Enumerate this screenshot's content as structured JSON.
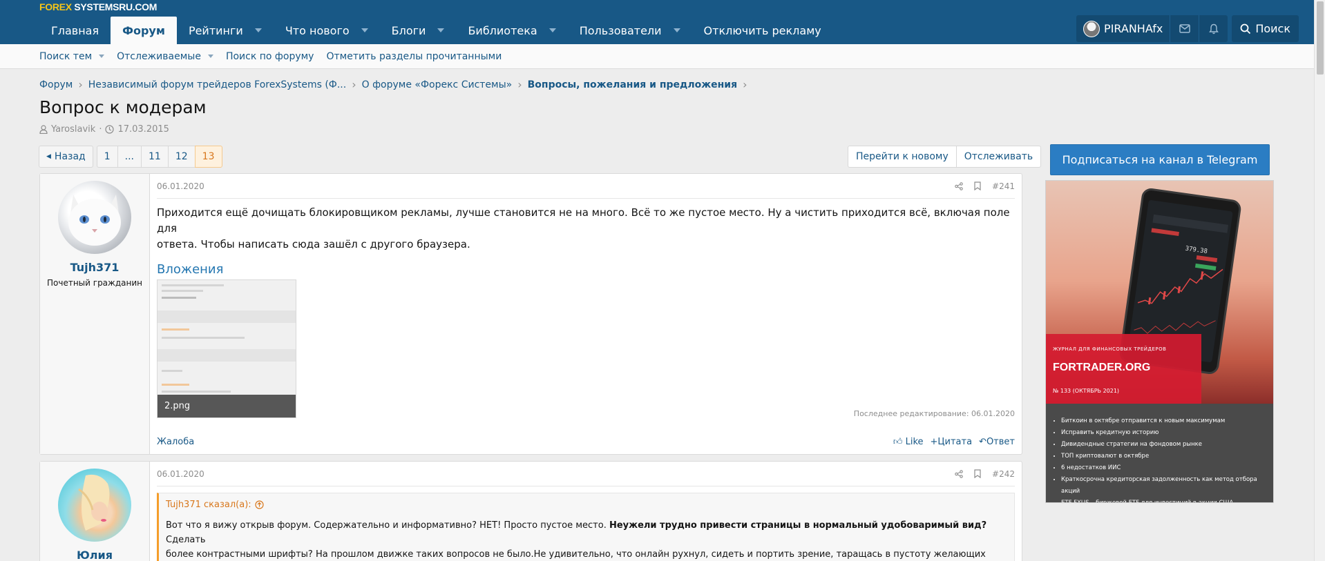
{
  "logo": {
    "part1": "FOREX",
    "part2": " SYSTEMSRU.COM"
  },
  "nav": {
    "items": [
      {
        "label": "Главная"
      },
      {
        "label": "Форум"
      },
      {
        "label": "Рейтинги"
      },
      {
        "label": "Что нового"
      },
      {
        "label": "Блоги"
      },
      {
        "label": "Библиотека"
      },
      {
        "label": "Пользователи"
      },
      {
        "label": "Отключить рекламу"
      }
    ],
    "active": "Форум",
    "username": "PIRANHAfx",
    "search_label": "Поиск"
  },
  "subnav": {
    "items": [
      {
        "label": "Поиск тем"
      },
      {
        "label": "Отслеживаемые"
      },
      {
        "label": "Поиск по форуму"
      },
      {
        "label": "Отметить разделы прочитанными"
      }
    ]
  },
  "breadcrumb": [
    "Форум",
    "Независимый форум трейдеров ForexSystems (Ф...",
    "О форуме «Форекс Системы»",
    "Вопросы, пожелания и предложения"
  ],
  "thread": {
    "title": "Вопрос к модерам",
    "author": "Yaroslavik",
    "date": "17.03.2015"
  },
  "pager": {
    "back": "Назад",
    "pages": [
      "1",
      "...",
      "11",
      "12",
      "13"
    ],
    "current": "13"
  },
  "thread_actions": {
    "goto_new": "Перейти к новому",
    "watch": "Отслеживать"
  },
  "posts": [
    {
      "username": "Tujh371",
      "usertitle": "Почетный гражданин",
      "date": "06.01.2020",
      "number": "#241",
      "body_line1": "Приходится ещё дочищать блокировщиком рекламы, лучше становится не на много. Всё то же пустое место. Ну а чистить приходится всё, включая поле для",
      "body_line2": "ответа. Чтобы написать сюда зашёл с другого браузера.",
      "attachments_label": "Вложения",
      "attachment_name": "2.png",
      "edited": "Последнее редактирование: 06.01.2020",
      "report": "Жалоба",
      "like": "Like",
      "quote": "Цитата",
      "reply": "Ответ"
    },
    {
      "username": "Юлия",
      "date": "06.01.2020",
      "number": "#242",
      "quote_author": "Tujh371 сказал(а):",
      "quote_text_start": "Вот что я вижу открыв форум. Содержательно и информативно? НЕТ! Просто пустое место. ",
      "quote_text_bold": "Неужели трудно привести страницы в нормальный удобоваримый вид?",
      "quote_text_end": " Сделать",
      "quote_line2": "более контрастными шрифты? На прошлом движке таких вопросов не было.Не удивительно, что онлайн рухнул, сидеть и портить зрение, таращась в пустоту желающих мало???"
    }
  ],
  "telegram": {
    "button": "Подписаться на канал в Telegram",
    "ad": {
      "kicker": "ЖУРНАЛ ДЛЯ ФИНАНСОВЫХ ТРЕЙДЕРОВ",
      "brand": "FORTRADER.ORG",
      "issue": "№ 133 (ОКТЯБРЬ 2021)",
      "phone_value": "379.38",
      "items": [
        "Биткоин в октябре отправится к новым максимумам",
        "Исправить кредитную историю",
        "Дивидендные стратегии на фондовом рынке",
        "ТОП криптовалют в октябре",
        "6 недостатков ИИС",
        "Краткосрочна кредиторская задолженность как метод отбора акций",
        "ETF FXUS – биржевой ETF для инвестиций в акции США"
      ]
    }
  }
}
